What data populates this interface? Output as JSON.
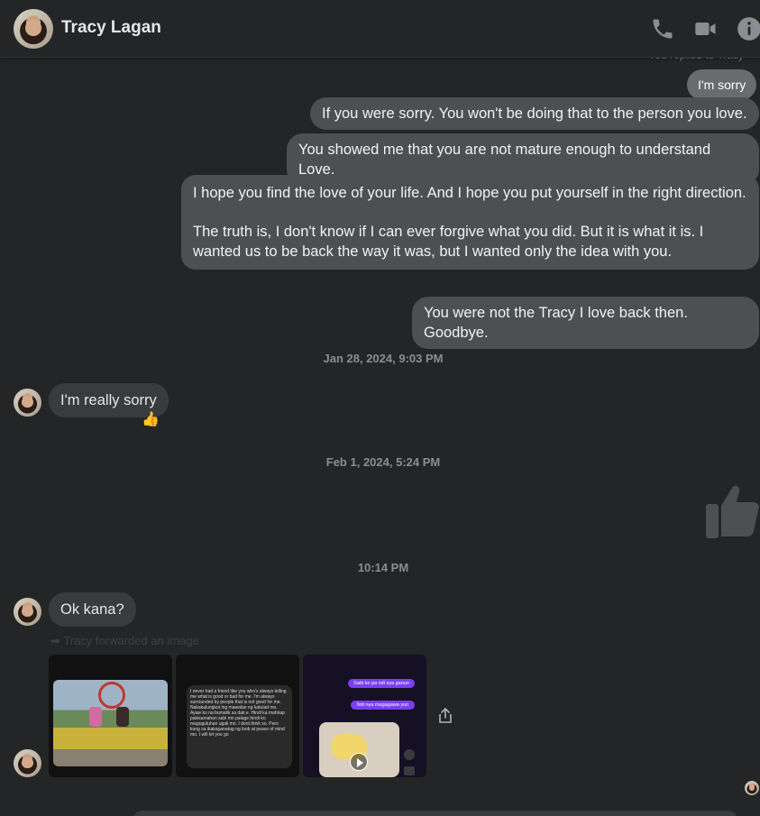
{
  "header": {
    "contact_name": "Tracy Lagan"
  },
  "thread": {
    "faded_top_note": "You replied to Tracy",
    "messages_out_1": "I'm sorry",
    "messages_out_2": "If you were sorry. You won't be doing that to the person you love.",
    "messages_out_3": "You showed me that you are not mature enough to understand Love.",
    "messages_out_4_p1": "I hope you find the love of your life. And I hope you put yourself in the right direction.",
    "messages_out_4_p2": "The truth is, I don't know if I can ever forgive what you did. But it is what it is. I wanted us to be back the way it was, but I wanted only the idea with you.",
    "messages_out_5": "You were not the Tracy I love back then. Goodbye.",
    "timestamp_1": "Jan 28, 2024, 9:03 PM",
    "messages_in_1": "I'm really sorry",
    "reaction_1": "👍",
    "timestamp_2": "Feb 1, 2024, 5:24 PM",
    "timestamp_3": "10:14 PM",
    "messages_in_2": "Ok kana?",
    "forward_note": "Tracy forwarded an image",
    "screenshot_text": "I never had a friend like you who's always telling me what is good or bad for me. I'm always surrounded by people that is not good for me. Nakakalungkot ing mawalan ng katulad mo. Ayaw ko na bumalik sa dati e. Hindi ka mahirap pakisamahan sabi mo palage hindi ko maguguluhan ugali mo. I dont think so. Pero kung sa ikakapanatag ng loob at peace of mind mo. I will let you go",
    "chat_bubble_1": "Sabi ko pa ndi sya ganun",
    "chat_bubble_2": "Ndi nya magagawa yun"
  }
}
